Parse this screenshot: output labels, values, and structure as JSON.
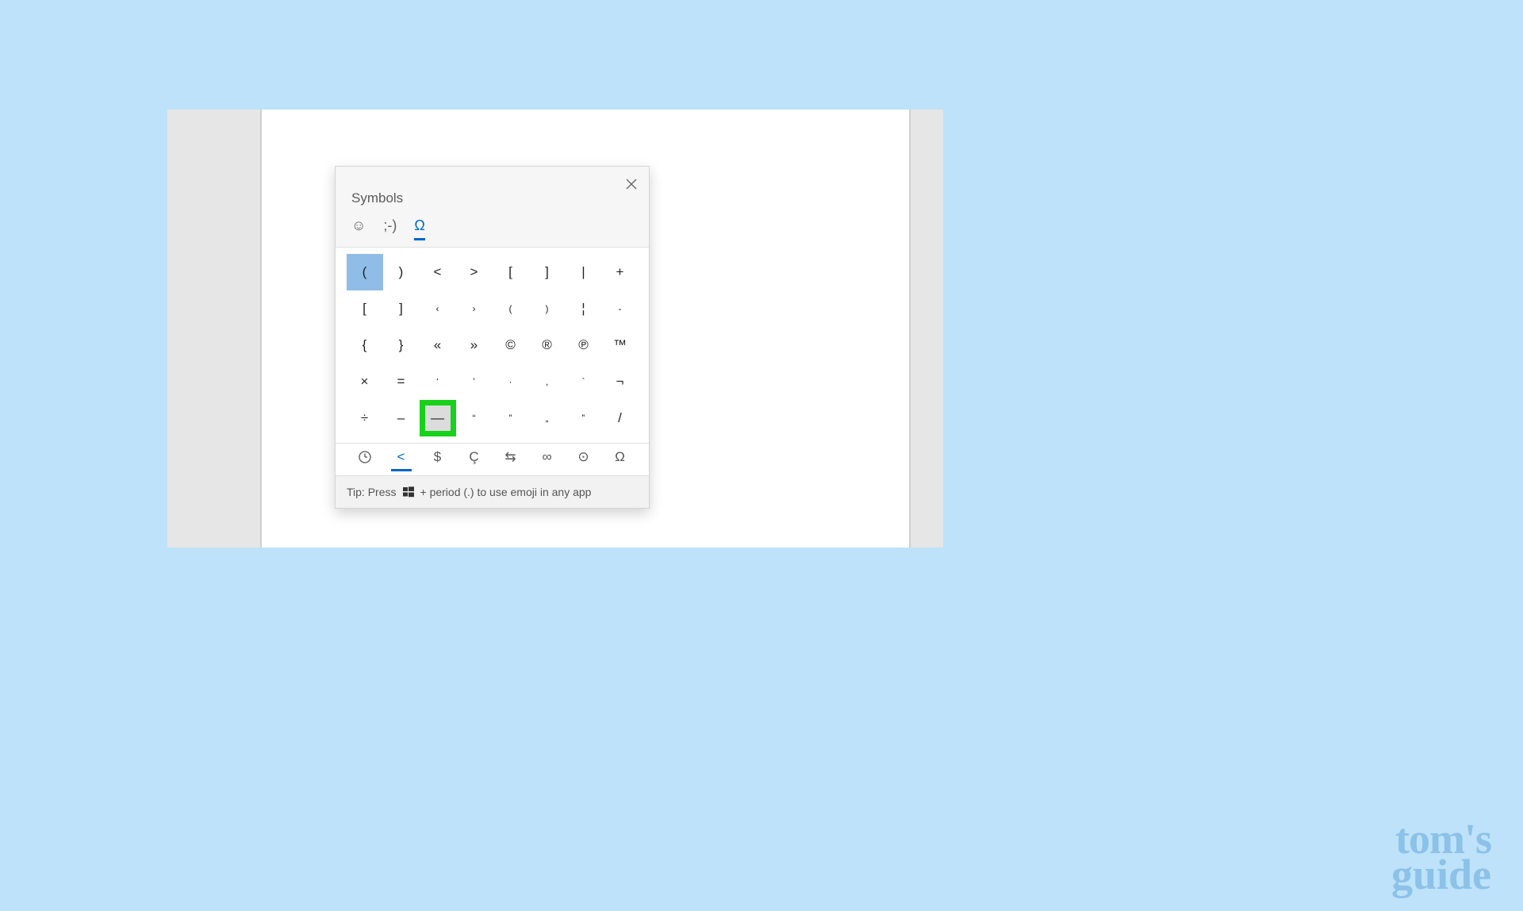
{
  "panel": {
    "title": "Symbols",
    "close_label": "×",
    "tabs": [
      {
        "id": "emoji",
        "glyph": "☺",
        "active": false
      },
      {
        "id": "kaomoji",
        "glyph": ";-)",
        "active": false
      },
      {
        "id": "symbols",
        "glyph": "Ω",
        "active": true
      }
    ],
    "grid": [
      [
        {
          "g": "(",
          "selected": true
        },
        {
          "g": ")"
        },
        {
          "g": "<"
        },
        {
          "g": ">"
        },
        {
          "g": "["
        },
        {
          "g": "]"
        },
        {
          "g": "|"
        },
        {
          "g": "+"
        }
      ],
      [
        {
          "g": "["
        },
        {
          "g": "]"
        },
        {
          "g": "‹",
          "small": true
        },
        {
          "g": "›",
          "small": true
        },
        {
          "g": "(",
          "small": true
        },
        {
          "g": ")",
          "small": true
        },
        {
          "g": "¦"
        },
        {
          "g": "-",
          "small": true
        }
      ],
      [
        {
          "g": "{"
        },
        {
          "g": "}"
        },
        {
          "g": "«"
        },
        {
          "g": "»"
        },
        {
          "g": "©"
        },
        {
          "g": "®"
        },
        {
          "g": "℗"
        },
        {
          "g": "™"
        }
      ],
      [
        {
          "g": "×"
        },
        {
          "g": "="
        },
        {
          "g": "‘",
          "small": true
        },
        {
          "g": "’",
          "small": true
        },
        {
          "g": "·",
          "small": true
        },
        {
          "g": ",",
          "small": true
        },
        {
          "g": "`",
          "small": true
        },
        {
          "g": "¬"
        }
      ],
      [
        {
          "g": "÷"
        },
        {
          "g": "–"
        },
        {
          "g": "—",
          "highlighted": true
        },
        {
          "g": "“",
          "small": true
        },
        {
          "g": "”",
          "small": true
        },
        {
          "g": "„",
          "small": true
        },
        {
          "g": "‟",
          "small": true
        },
        {
          "g": "/"
        }
      ]
    ],
    "categories": [
      {
        "id": "recent",
        "glyph": "◷",
        "active": false
      },
      {
        "id": "punct",
        "glyph": "<",
        "active": true
      },
      {
        "id": "currency",
        "glyph": "$",
        "active": false
      },
      {
        "id": "latin",
        "glyph": "Ç",
        "active": false
      },
      {
        "id": "arrows",
        "glyph": "⇆",
        "active": false
      },
      {
        "id": "math",
        "glyph": "∞",
        "active": false
      },
      {
        "id": "geom",
        "glyph": "⊙",
        "active": false
      },
      {
        "id": "lang",
        "glyph": "Ω",
        "active": false
      }
    ],
    "tip_prefix": "Tip: Press",
    "tip_suffix": "+ period (.) to use emoji in any app"
  },
  "watermark": {
    "line1": "tom's",
    "line2": "guide"
  }
}
